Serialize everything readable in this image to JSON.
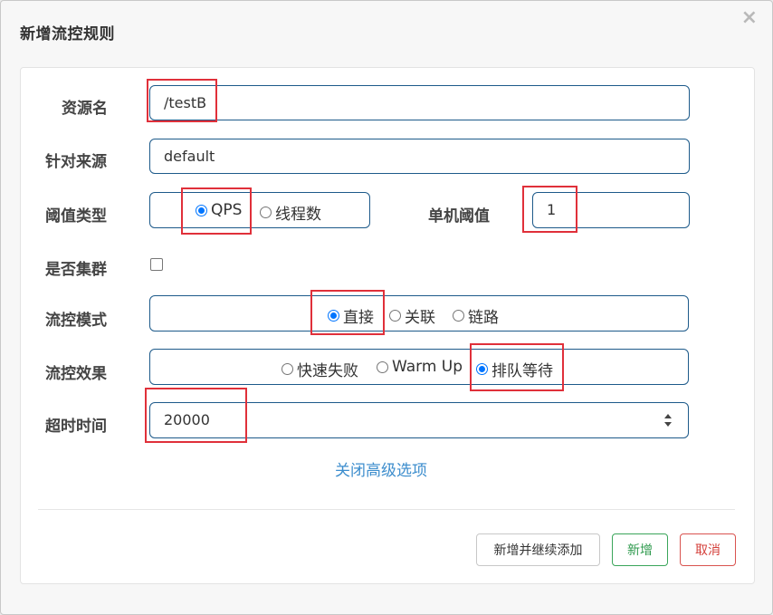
{
  "dialog": {
    "title": "新增流控规则",
    "close_label": "×"
  },
  "form": {
    "resource_name": {
      "label": "资源名",
      "value": "/testB"
    },
    "limit_app": {
      "label": "针对来源",
      "value": "default"
    },
    "grade": {
      "label": "阈值类型",
      "options": [
        {
          "label": "QPS",
          "checked": true
        },
        {
          "label": "线程数",
          "checked": false
        }
      ]
    },
    "threshold": {
      "label": "单机阈值",
      "value": "1"
    },
    "cluster": {
      "label": "是否集群",
      "checked": false
    },
    "strategy": {
      "label": "流控模式",
      "options": [
        {
          "label": "直接",
          "checked": true
        },
        {
          "label": "关联",
          "checked": false
        },
        {
          "label": "链路",
          "checked": false
        }
      ]
    },
    "control_behavior": {
      "label": "流控效果",
      "options": [
        {
          "label": "快速失败",
          "checked": false
        },
        {
          "label": "Warm Up",
          "checked": false
        },
        {
          "label": "排队等待",
          "checked": true
        }
      ]
    },
    "timeout": {
      "label": "超时时间",
      "value": "20000"
    },
    "advanced_toggle_label": "关闭高级选项"
  },
  "footer": {
    "add_continue_label": "新增并继续添加",
    "add_label": "新增",
    "cancel_label": "取消"
  },
  "colors": {
    "radio_checked": "#0075ff",
    "highlight_box": "#e0303a",
    "field_border": "#1d5a8a",
    "link": "#3c8dcd"
  }
}
